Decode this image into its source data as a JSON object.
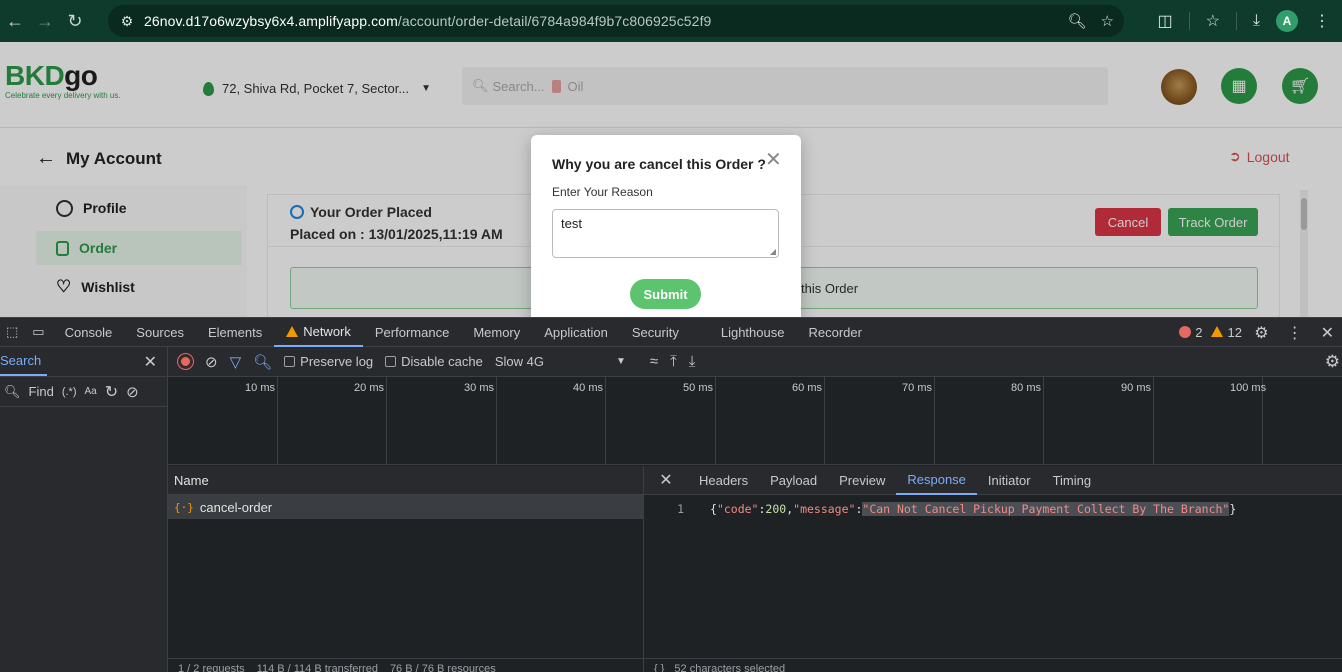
{
  "browser": {
    "url_host": "26nov.d17o6wzybsy6x4.amplifyapp.com",
    "url_path": "/account/order-detail/6784a984f9b7c806925c52f9",
    "profile_initial": "A"
  },
  "site": {
    "logo_brand_a": "BKD",
    "logo_brand_b": "go",
    "logo_tagline": "Celebrate every delivery with us.",
    "location": "72, Shiva Rd, Pocket 7, Sector...",
    "search_prefix": "Search...",
    "search_hint": "Oil"
  },
  "account": {
    "heading": "My Account",
    "logout": "Logout",
    "menu": [
      {
        "label": "Profile"
      },
      {
        "label": "Order"
      },
      {
        "label": "Wishlist"
      }
    ]
  },
  "order": {
    "status": "Your Order Placed",
    "placed_on": "Placed on : 13/01/2025,11:19 AM",
    "cancel_label": "Cancel",
    "track_label": "Track Order",
    "notice_fragment": "this Order"
  },
  "modal": {
    "title": "Why you are cancel this Order ?",
    "label": "Enter Your Reason",
    "reason_value": "test",
    "submit_label": "Submit"
  },
  "devtools": {
    "tabs": [
      "Console",
      "Sources",
      "Elements",
      "Network",
      "Performance",
      "Memory",
      "Application",
      "Security",
      "Lighthouse",
      "Recorder"
    ],
    "active_tab": "Network",
    "errors": "2",
    "warnings": "12",
    "search_label": "Search",
    "find_label": "Find",
    "regex_label": "(.*)",
    "case_label": "Aa",
    "preserve_log": "Preserve log",
    "disable_cache": "Disable cache",
    "throttling": "Slow 4G",
    "timeline_ticks": [
      "10 ms",
      "20 ms",
      "30 ms",
      "40 ms",
      "50 ms",
      "60 ms",
      "70 ms",
      "80 ms",
      "90 ms",
      "100 ms",
      "11"
    ],
    "name_header": "Name",
    "request_name": "cancel-order",
    "request_footer": [
      "1 / 2 requests",
      "114 B / 114 B transferred",
      "76 B / 76 B resources"
    ],
    "detail_tabs": [
      "Headers",
      "Payload",
      "Preview",
      "Response",
      "Initiator",
      "Timing"
    ],
    "active_detail_tab": "Response",
    "response_line_no": "1",
    "response": {
      "open": "{",
      "key_code": "\"code\"",
      "colon": ":",
      "code_value": "200",
      "comma": ",",
      "key_message": "\"message\"",
      "message_value": "\"Can Not Cancel Pickup Payment Collect By The Branch\"",
      "close": "}"
    },
    "detail_footer": "52 characters selected"
  }
}
